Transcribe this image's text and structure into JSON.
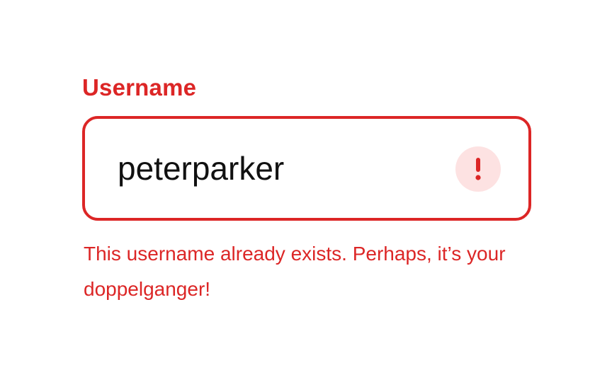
{
  "field": {
    "label": "Username",
    "value": "peterparker",
    "error_message": "This username already exists. Perhaps, it’s your doppelganger!",
    "error_icon": "exclamation-icon"
  },
  "colors": {
    "error": "#dc2626",
    "error_icon_bg": "#fde2e2",
    "text": "#111111"
  }
}
